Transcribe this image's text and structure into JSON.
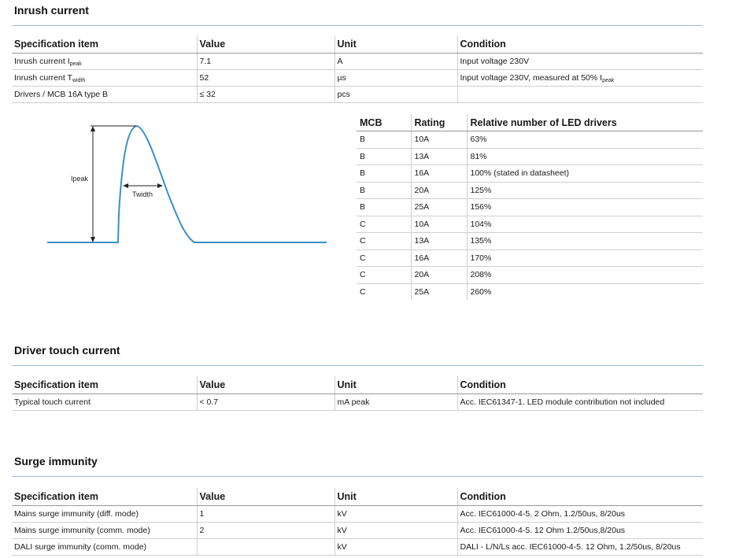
{
  "inrush": {
    "title": "Inrush current",
    "headers": [
      "Specification item",
      "Value",
      "Unit",
      "Condition"
    ],
    "rows": [
      {
        "item": "Inrush current I",
        "item_sub": "peak",
        "value": "7.1",
        "unit": "A",
        "condition": "Input voltage 230V",
        "condition_sub": ""
      },
      {
        "item": "Inrush current T",
        "item_sub": "width",
        "value": "52",
        "unit": "µs",
        "condition": "Input voltage 230V, measured at 50% I",
        "condition_sub": "peak"
      },
      {
        "item": "Drivers / MCB 16A type B",
        "item_sub": "",
        "value": "≤ 32",
        "unit": "pcs",
        "condition": "",
        "condition_sub": ""
      }
    ]
  },
  "waveform": {
    "label_peak": "Ipeak",
    "label_width": "Twidth",
    "line_color": "#3a8fc9"
  },
  "mcb_table": {
    "headers": [
      "MCB",
      "Rating",
      "Relative number of LED drivers"
    ],
    "rows": [
      {
        "mcb": "B",
        "rating": "10A",
        "relative": "63%"
      },
      {
        "mcb": "B",
        "rating": "13A",
        "relative": "81%"
      },
      {
        "mcb": "B",
        "rating": "16A",
        "relative": "100% (stated in datasheet)"
      },
      {
        "mcb": "B",
        "rating": "20A",
        "relative": "125%"
      },
      {
        "mcb": "B",
        "rating": "25A",
        "relative": "156%"
      },
      {
        "mcb": "C",
        "rating": "10A",
        "relative": "104%"
      },
      {
        "mcb": "C",
        "rating": "13A",
        "relative": "135%"
      },
      {
        "mcb": "C",
        "rating": "16A",
        "relative": "170%"
      },
      {
        "mcb": "C",
        "rating": "20A",
        "relative": "208%"
      },
      {
        "mcb": "C",
        "rating": "25A",
        "relative": "260%"
      }
    ]
  },
  "touch": {
    "title": "Driver touch current",
    "headers": [
      "Specification item",
      "Value",
      "Unit",
      "Condition"
    ],
    "rows": [
      {
        "item": "Typical touch current",
        "value": "< 0.7",
        "unit": "mA peak",
        "condition": "Acc. IEC61347-1. LED module contribution not included"
      }
    ]
  },
  "surge": {
    "title": "Surge immunity",
    "headers": [
      "Specification item",
      "Value",
      "Unit",
      "Condition"
    ],
    "rows": [
      {
        "item": "Mains surge immunity (diff. mode)",
        "value": "1",
        "unit": "kV",
        "condition": "Acc. IEC61000-4-5. 2 Ohm, 1.2/50us, 8/20us"
      },
      {
        "item": "Mains surge immunity (comm. mode)",
        "value": "2",
        "unit": "kV",
        "condition": "Acc. IEC61000-4-5. 12 Ohm 1.2/50us,8/20us"
      },
      {
        "item": "DALI surge immunity (comm. mode)",
        "value": "",
        "unit": "kV",
        "condition": "DALI - L/N/Ls acc. IEC61000-4-5. 12 Ohm, 1.2/50us, 8/20us"
      }
    ]
  }
}
